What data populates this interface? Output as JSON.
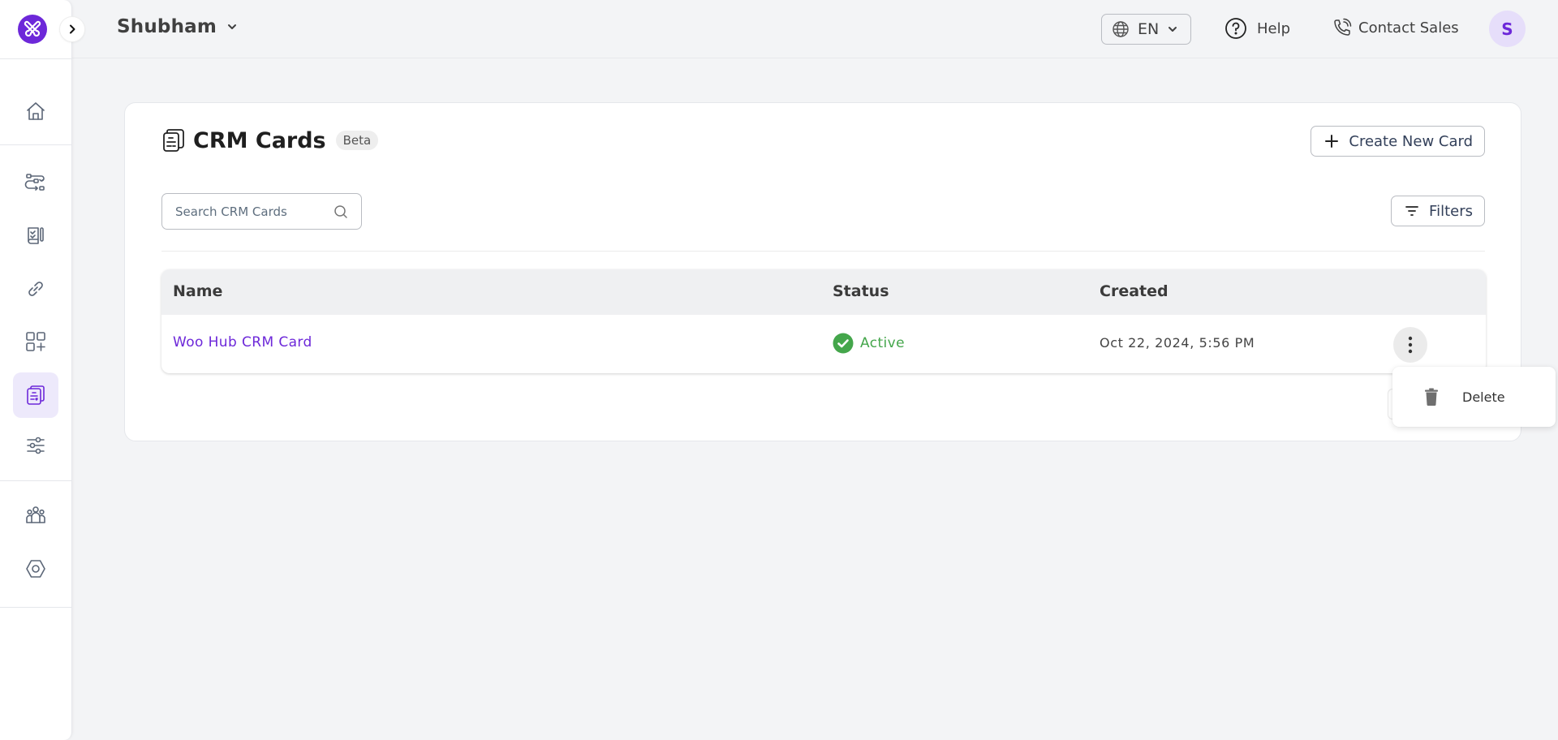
{
  "app": {
    "logo_icon": "brand-logo-icon",
    "expand_icon": "chevron-right-icon"
  },
  "sidebar": {
    "items": [
      {
        "id": "home",
        "icon": "home-icon",
        "active": false
      },
      {
        "id": "workflows",
        "icon": "workflow-icon",
        "active": false
      },
      {
        "id": "forms",
        "icon": "checklist-document-icon",
        "active": false
      },
      {
        "id": "integrations",
        "icon": "link-icon",
        "active": false
      },
      {
        "id": "apps",
        "icon": "add-apps-icon",
        "active": false
      },
      {
        "id": "crm-cards",
        "icon": "crm-cards-icon",
        "active": true
      },
      {
        "id": "settings-sliders",
        "icon": "sliders-icon",
        "active": false
      },
      {
        "id": "team",
        "icon": "users-icon",
        "active": false
      },
      {
        "id": "settings",
        "icon": "hexagon-settings-icon",
        "active": false
      }
    ]
  },
  "topbar": {
    "workspace_name": "Shubham",
    "language": "EN",
    "help_label": "Help",
    "contact_sales_label": "Contact Sales",
    "avatar_initial": "S"
  },
  "page": {
    "title": "CRM Cards",
    "badge": "Beta",
    "create_button_label": "Create New Card",
    "search_placeholder": "Search CRM Cards",
    "search_value": "",
    "filters_label": "Filters"
  },
  "table": {
    "columns": [
      "Name",
      "Status",
      "Created"
    ],
    "rows": [
      {
        "name": "Woo Hub CRM Card",
        "status": "Active",
        "created": "Oct 22, 2024, 5:56 PM"
      }
    ]
  },
  "row_menu": {
    "items": [
      {
        "label": "Delete",
        "icon": "trash-icon"
      }
    ]
  },
  "colors": {
    "brand": "#6d28d9",
    "active_status": "#44a64b",
    "active_nav_bg": "#ede9fb"
  }
}
